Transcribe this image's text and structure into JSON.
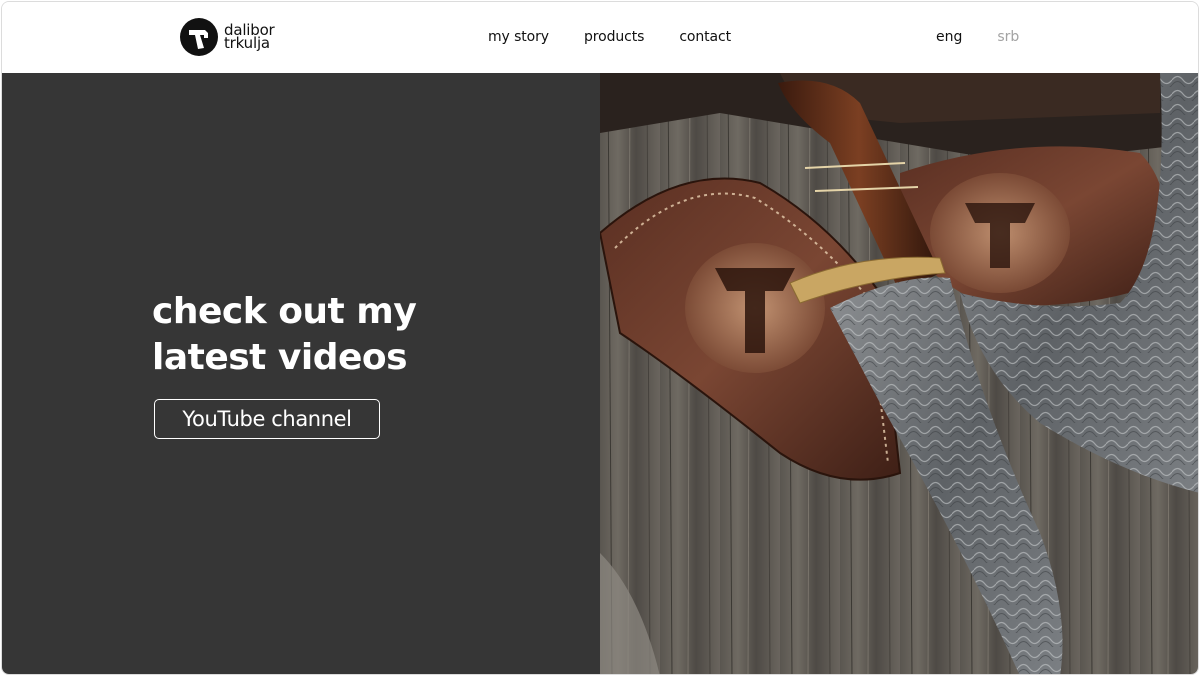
{
  "brand": {
    "line1": "dalibor",
    "line2": "trkulja",
    "icon": "hammer-logo-icon"
  },
  "nav": {
    "items": [
      {
        "label": "my story"
      },
      {
        "label": "products"
      },
      {
        "label": "contact"
      }
    ]
  },
  "lang": {
    "active": "eng",
    "inactive": "srb"
  },
  "hero": {
    "title_line1": "check out my",
    "title_line2": "latest videos",
    "button_label": "YouTube channel",
    "image": "damascus-knife-with-leather-sheath-photo"
  },
  "colors": {
    "hero_bg": "#363636",
    "text_dark": "#111111",
    "lang_inactive": "#a3a3a3",
    "button_border": "#ffffff"
  }
}
